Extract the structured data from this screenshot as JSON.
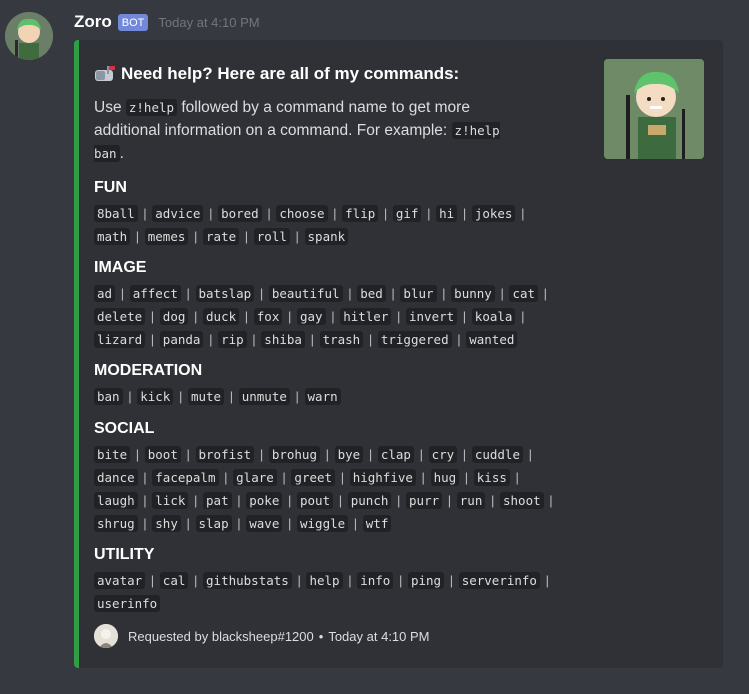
{
  "message": {
    "username": "Zoro",
    "bot_tag": "BOT",
    "timestamp": "Today at 4:10 PM"
  },
  "embed": {
    "accent_color": "#2f9e44",
    "title": "Need help? Here are all of my commands:",
    "title_icon": "mailbox-icon",
    "description_before": "Use ",
    "description_code1": "z!help",
    "description_middle": " followed by a command name to get more additional information on a command. For example: ",
    "description_code2": "z!help ban",
    "description_after": ".",
    "fields": [
      {
        "name": "FUN",
        "commands": [
          "8ball",
          "advice",
          "bored",
          "choose",
          "flip",
          "gif",
          "hi",
          "jokes",
          "math",
          "memes",
          "rate",
          "roll",
          "spank"
        ]
      },
      {
        "name": "IMAGE",
        "commands": [
          "ad",
          "affect",
          "batslap",
          "beautiful",
          "bed",
          "blur",
          "bunny",
          "cat",
          "delete",
          "dog",
          "duck",
          "fox",
          "gay",
          "hitler",
          "invert",
          "koala",
          "lizard",
          "panda",
          "rip",
          "shiba",
          "trash",
          "triggered",
          "wanted"
        ]
      },
      {
        "name": "MODERATION",
        "commands": [
          "ban",
          "kick",
          "mute",
          "unmute",
          "warn"
        ]
      },
      {
        "name": "SOCIAL",
        "commands": [
          "bite",
          "boot",
          "brofist",
          "brohug",
          "bye",
          "clap",
          "cry",
          "cuddle",
          "dance",
          "facepalm",
          "glare",
          "greet",
          "highfive",
          "hug",
          "kiss",
          "laugh",
          "lick",
          "pat",
          "poke",
          "pout",
          "punch",
          "purr",
          "run",
          "shoot",
          "shrug",
          "shy",
          "slap",
          "wave",
          "wiggle",
          "wtf"
        ]
      },
      {
        "name": "UTILITY",
        "commands": [
          "avatar",
          "cal",
          "githubstats",
          "help",
          "info",
          "ping",
          "serverinfo",
          "userinfo"
        ]
      }
    ],
    "footer_text": "Requested by blacksheep#1200",
    "footer_separator": "•",
    "footer_time": "Today at 4:10 PM"
  }
}
